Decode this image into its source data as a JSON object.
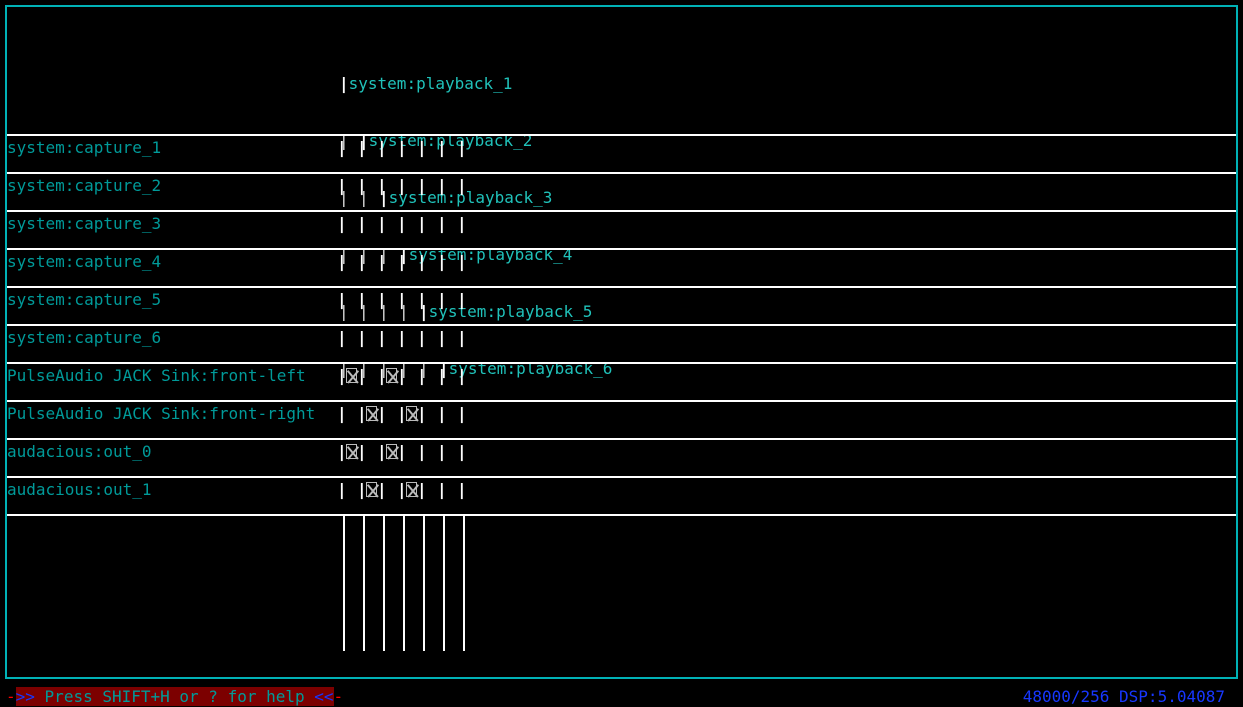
{
  "columns": [
    "system:playback_1",
    "system:playback_2",
    "system:playback_3",
    "system:playback_4",
    "system:playback_5",
    "system:playback_6"
  ],
  "rows": [
    {
      "name": "system:capture_1",
      "cells": [
        0,
        0,
        0,
        0,
        0,
        0
      ]
    },
    {
      "name": "system:capture_2",
      "cells": [
        0,
        0,
        0,
        0,
        0,
        0
      ]
    },
    {
      "name": "system:capture_3",
      "cells": [
        0,
        0,
        0,
        0,
        0,
        0
      ]
    },
    {
      "name": "system:capture_4",
      "cells": [
        0,
        0,
        0,
        0,
        0,
        0
      ]
    },
    {
      "name": "system:capture_5",
      "cells": [
        0,
        0,
        0,
        0,
        0,
        0
      ]
    },
    {
      "name": "system:capture_6",
      "cells": [
        0,
        0,
        0,
        0,
        0,
        0
      ]
    },
    {
      "name": "PulseAudio JACK Sink:front-left",
      "cells": [
        1,
        0,
        1,
        0,
        0,
        0
      ]
    },
    {
      "name": "PulseAudio JACK Sink:front-right",
      "cells": [
        0,
        1,
        0,
        1,
        0,
        0
      ]
    },
    {
      "name": "audacious:out_0",
      "cells": [
        1,
        0,
        1,
        0,
        0,
        0
      ]
    },
    {
      "name": "audacious:out_1",
      "cells": [
        0,
        1,
        0,
        1,
        0,
        0
      ]
    }
  ],
  "footer": {
    "help_prefix": "-",
    "help_arrow_l": ">> ",
    "help_text": "Press SHIFT+H or ? for help",
    "help_arrow_r": " <<",
    "help_suffix": "-",
    "status": "48000/256 DSP:5.04087"
  }
}
